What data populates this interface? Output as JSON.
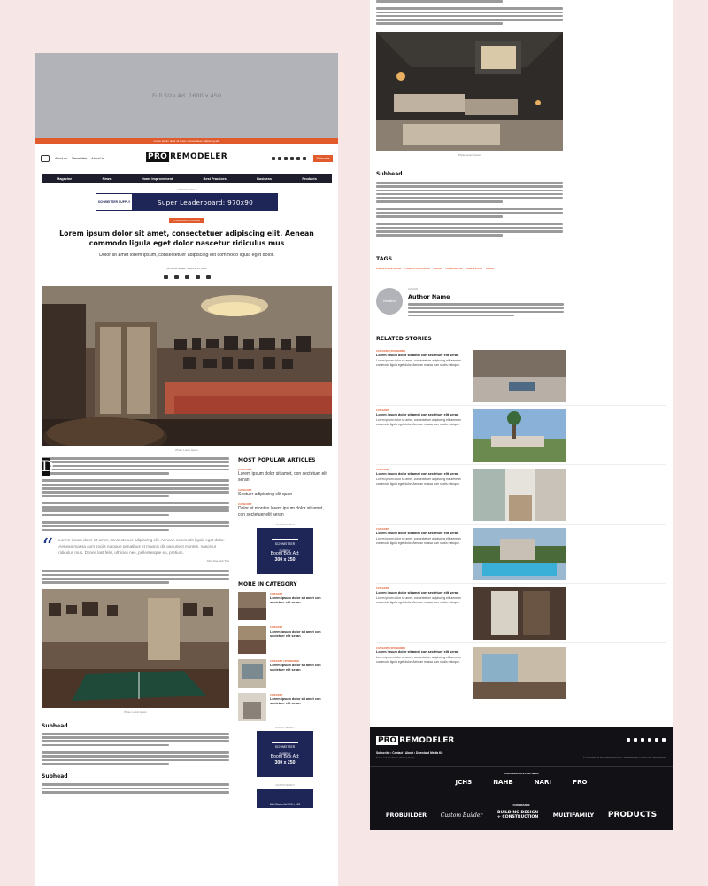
{
  "left": {
    "ad_top": "Full Size Ad, 1600 x 450",
    "strip_text": "Lorem ipsum dolor sit amet, consectetuer adipiscing elit.",
    "header": {
      "small_nav": [
        "About us",
        "Newsletter",
        "About Us"
      ],
      "logo_pro": "PRO",
      "logo_rest": "REMODELER",
      "subscribe": "Subscribe"
    },
    "nav": [
      "Magazine",
      "News",
      "Home Improvement",
      "Best Practices",
      "Business",
      "Products"
    ],
    "advertisement": "ADVERTISEMENT",
    "leaderboard": {
      "brand": "SCHWEITZER SUPPLY",
      "text": "Super Leaderboard: 970x90"
    },
    "category_pill": "LOREM IPSUM DOLOR",
    "title": "Lorem ipsum dolor sit amet, consectetuer adipiscing elit. Aenean commodo ligula eget dolor nascetur ridiculus mus",
    "deck": "Dolor sit amet lorem ipsum, consectetuer adipiscing elit commodo ligula eget dolor.",
    "byline": "AUTHOR NAME · MARCH 16, 2024",
    "hero_caption": "Photo: Lorem Ipsum",
    "dropcap": "D",
    "quote": {
      "text": "Lorem ipsum dolor sit amet, consectetuer adipiscing elit. Aenean commodo ligula eget dolor. Aenean massa cum sociis natoque penatibus et magnis dis parturient montes, nascetur ridiculus mus. Donec last felis, ultricies nec, pellentesque eu, pretium.",
      "author": "John Doe, Job Title"
    },
    "img2_caption": "Photo: Lorem Ipsum",
    "subhead1": "Subhead",
    "subhead2": "Subhead",
    "sidebar": {
      "popular_h": "MOST POPULAR ARTICLES",
      "popular": [
        {
          "cat": "CATEGORY",
          "title": "Lorem ipsum dolor sit amet, con sectetuer elit seran"
        },
        {
          "cat": "CATEGORY",
          "title": "Sectuer adipiscing elit quan"
        },
        {
          "cat": "CATEGORY",
          "title": "Dolor et montes lorem ipsum dolor sit amet, con sectetuer elit seran"
        }
      ],
      "boom1": {
        "brand": "SCHWEITZER SUPPLY",
        "label": "Boom Box Ad:",
        "size": "300 x 250"
      },
      "more_h": "MORE IN CATEGORY",
      "more": [
        {
          "cat": "CATEGORY",
          "title": "Lorem ipsum dolor sit amet con sectetuer elit seran"
        },
        {
          "cat": "CATEGORY",
          "title": "Lorem ipsum dolor sit amet con sectetuer elit seran"
        },
        {
          "cat": "CATEGORY | SPONSORED",
          "title": "Lorem ipsum dolor sit amet con sectetuer elit seran"
        },
        {
          "cat": "CATEGORY",
          "title": "Lorem ipsum dolor sit amet con sectetuer elit seran"
        }
      ],
      "boom2": {
        "brand": "SCHWEITZER SUPPLY",
        "label": "Boom Box Ad:",
        "size": "300 x 250"
      },
      "boom3": "Mini Boom Ad 300 x 100"
    }
  },
  "right": {
    "img_caption": "Photo: Lorem Ipsum",
    "subhead": "Subhead",
    "tags_h": "TAGS",
    "tags": [
      "LOREM IPSUM DOLOR",
      "LOREM IPSUM DOLOR",
      "DOLOR",
      "LOREM DOLOR",
      "LOREM IPSUM",
      "DOLOR"
    ],
    "author": {
      "label": "AUTHOR",
      "avatar": "Headshot",
      "name": "Author Name"
    },
    "related_h": "RELATED STORIES",
    "related": [
      {
        "cat": "CATEGORY | SPONSORED",
        "title": "Lorem ipsum dolor sit amet con sectetuer elit seran",
        "desc": "Lorem ipsum dolor sit amet, consectetuer adipiscing elit aenean commodo ligula eget dolor. Aenean massa cum sociis natoque."
      },
      {
        "cat": "CATEGORY",
        "title": "Lorem ipsum dolor sit amet con sectetuer elit seran",
        "desc": "Lorem ipsum dolor sit amet, consectetuer adipiscing elit aenean commodo ligula eget dolor. Aenean massa cum sociis natoque."
      },
      {
        "cat": "CATEGORY",
        "title": "Lorem ipsum dolor sit amet con sectetuer elit seran",
        "desc": "Lorem ipsum dolor sit amet, consectetuer adipiscing elit aenean commodo ligula eget dolor. Aenean massa cum sociis natoque."
      },
      {
        "cat": "CATEGORY",
        "title": "Lorem ipsum dolor sit amet con sectetuer elit seran",
        "desc": "Lorem ipsum dolor sit amet, consectetuer adipiscing elit aenean commodo ligula eget dolor. Aenean massa cum sociis natoque."
      },
      {
        "cat": "CATEGORY",
        "title": "Lorem ipsum dolor sit amet con sectetuer elit seran",
        "desc": "Lorem ipsum dolor sit amet, consectetuer adipiscing elit aenean commodo ligula eget dolor. Aenean massa cum sociis natoque."
      },
      {
        "cat": "CATEGORY | SPONSORED",
        "title": "Lorem ipsum dolor sit amet con sectetuer elit seran",
        "desc": "Lorem ipsum dolor sit amet, consectetuer adipiscing elit aenean commodo ligula eget dolor. Aenean massa cum sociis natoque."
      }
    ],
    "footer": {
      "logo_pro": "PRO",
      "logo_rest": "REMODELER",
      "links": "Subscribe • Contact • About • Download Media Kit",
      "copy_left": "Terms and Conditions | Privacy Policy",
      "copy_right": "© COPYRIGHT 2024 PROFESSIONAL REMODELER ALL RIGHTS RESERVED",
      "partners_h": "OUR ASSOCIATE PARTNERS",
      "partners": [
        "JCHS",
        "NAHB",
        "NARI",
        "PRO"
      ],
      "brands_h": "OUR BRANDS",
      "brands": [
        "PROBUILDER",
        "Custom Builder",
        "BUILDING DESIGN + CONSTRUCTION",
        "MULTIFAMILY",
        "PRODUCTS"
      ]
    }
  }
}
